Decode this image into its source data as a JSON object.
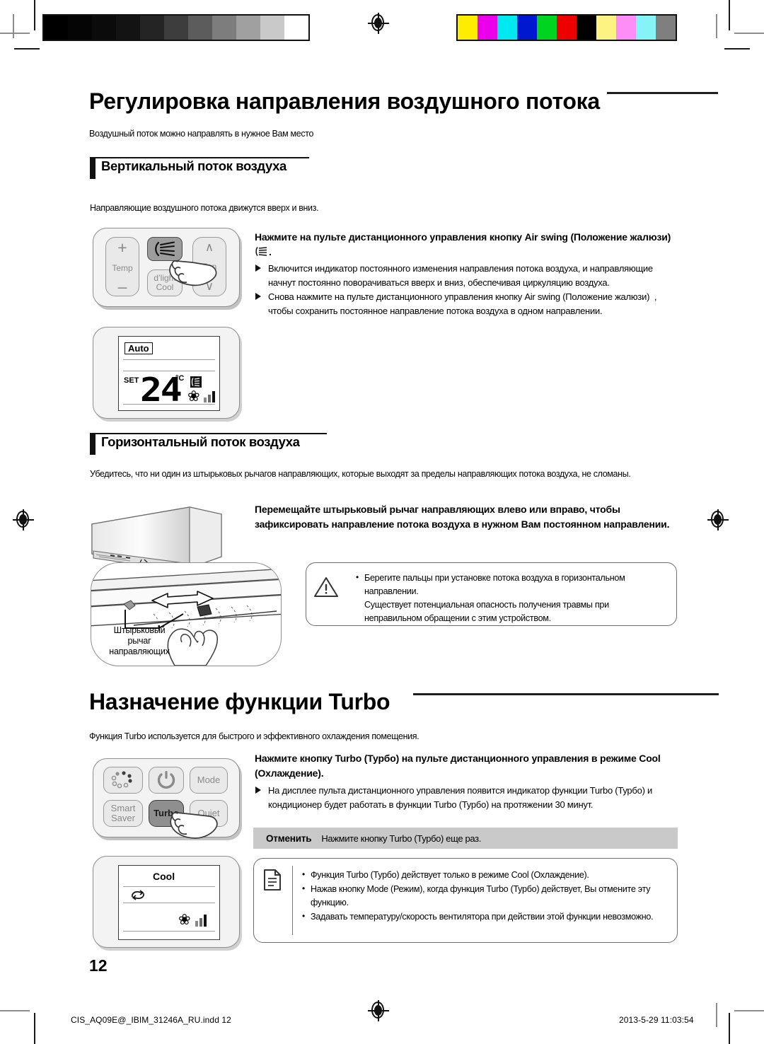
{
  "document": {
    "page_number": "12",
    "footer_left": "CIS_AQ09E@_IBIM_31246A_RU.indd   12",
    "footer_right": "2013-5-29   11:03:54"
  },
  "colorbar": {
    "grayscale": [
      "#000000",
      "#050505",
      "#0b0b0b",
      "#131313",
      "#242424",
      "#3d3d3d",
      "#5c5c5c",
      "#7d7d7d",
      "#a0a0a0",
      "#c9c9c9",
      "#ffffff"
    ],
    "colors": [
      "#ffed00",
      "#ec00ec",
      "#00e8f0",
      "#0018d0",
      "#00d320",
      "#ec0000",
      "#000000",
      "#fdf383",
      "#fd8ef7",
      "#86f4f6",
      "#7f7f7f"
    ]
  },
  "section1": {
    "title": "Регулировка направления воздушного потока",
    "intro": "Воздушный поток можно направлять в нужное Вам место",
    "sub1": {
      "heading": "Вертикальный поток воздуха",
      "intro": "Направляющие воздушного потока движутся вверх и вниз.",
      "instruction": "Нажмите на пульте дистанционного управления кнопку Air swing (Положение жалюзи) ",
      "instruction_tail": ".",
      "bullets": [
        "Включится индикатор постоянного изменения направления потока воздуха, и направляющие начнут постоянно поворачиваться вверх и вниз, обеспечивая циркуляцию воздуха.",
        "Снова нажмите на пульте дистанционного управления кнопку Air swing (Положение жалюзи)  , чтобы сохранить постоянное направление потока воздуха в одном направлении."
      ],
      "remote": {
        "buttons": [
          {
            "name": "temp-plus",
            "label": "+"
          },
          {
            "name": "temp-label",
            "label": "Temp"
          },
          {
            "name": "temp-minus",
            "label": "–"
          },
          {
            "name": "air-swing",
            "label": ""
          },
          {
            "name": "dlight-cool",
            "label": "d’light\nCool"
          },
          {
            "name": "fan-up",
            "label": "∧"
          },
          {
            "name": "fan-label",
            "label": "Fan"
          },
          {
            "name": "fan-down",
            "label": "∨"
          }
        ]
      },
      "lcd": {
        "mode": "Auto",
        "set_label": "SET",
        "temperature": "24",
        "unit": "°C"
      }
    },
    "sub2": {
      "heading": "Горизонтальный поток воздуха",
      "intro": "Убедитесь, что ни один из штырьковых рычагов направляющих, которые выходят за пределы направляющих потока воздуха, не сломаны.",
      "instruction": "Перемещайте штырьковый рычаг направляющих влево или вправо, чтобы зафиксировать направление потока воздуха в нужном Вам постоянном направлении.",
      "callout": "Штырьковый\nрычаг\nнаправляющих",
      "warning": {
        "icon": "warning-triangle-icon",
        "items": [
          "Берегите пальцы при установке потока воздуха в горизонтальном направлении.",
          "Существует потенциальная опасность получения травмы при неправильном обращении с этим устройством."
        ]
      }
    }
  },
  "section2": {
    "title": "Назначение функции Turbo",
    "intro": "Функция Turbo используется для быстрого и эффективного охлаждения помещения.",
    "instruction": "Нажмите кнопку Turbo (Турбо) на пульте дистанционного управления в режиме Cool (Охлаждение).",
    "bullets": [
      "На дисплее пульта дистанционного управления появится индикатор функции Turbo (Турбо) и кондиционер будет работать в функции Turbo (Турбо) на протяжении 30 минут."
    ],
    "cancel": {
      "label": "Отменить",
      "text": "Нажмите кнопку Turbo (Турбо) еще раз."
    },
    "note": {
      "icon": "note-document-icon",
      "items": [
        "Функция Turbo (Турбо) действует только в режиме Cool (Охлаждение).",
        "Нажав кнопку Mode (Режим), когда функция Turbo (Турбо) действует, Вы отмените эту функцию.",
        "Задавать температуру/скорость вентилятора при действии этой функции невозможно."
      ]
    },
    "remote": {
      "buttons": [
        {
          "name": "good-sleep",
          "label": ""
        },
        {
          "name": "power",
          "label": ""
        },
        {
          "name": "mode",
          "label": "Mode"
        },
        {
          "name": "smart-saver",
          "label": "Smart\nSaver"
        },
        {
          "name": "turbo",
          "label": "Turbo"
        },
        {
          "name": "quiet",
          "label": "Quiet"
        }
      ]
    },
    "lcd": {
      "mode": "Cool"
    }
  }
}
